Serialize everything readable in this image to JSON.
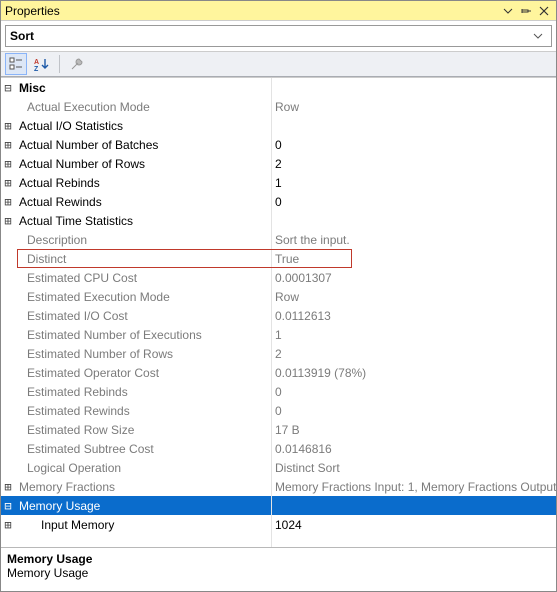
{
  "window": {
    "title": "Properties"
  },
  "object_name": "Sort",
  "category": {
    "label": "Misc"
  },
  "rows": [
    {
      "k": "actual-exec-mode",
      "label": "Actual Execution Mode",
      "value": "Row",
      "exp": "",
      "cls": "faded indent1"
    },
    {
      "k": "actual-io-stats",
      "label": "Actual I/O Statistics",
      "value": "",
      "exp": "⊞",
      "cls": "expandable"
    },
    {
      "k": "actual-batches",
      "label": "Actual Number of Batches",
      "value": "0",
      "exp": "⊞",
      "cls": "expandable"
    },
    {
      "k": "actual-rows",
      "label": "Actual Number of Rows",
      "value": "2",
      "exp": "⊞",
      "cls": "expandable"
    },
    {
      "k": "actual-rebinds",
      "label": "Actual Rebinds",
      "value": "1",
      "exp": "⊞",
      "cls": "expandable"
    },
    {
      "k": "actual-rewinds",
      "label": "Actual Rewinds",
      "value": "0",
      "exp": "⊞",
      "cls": "expandable"
    },
    {
      "k": "actual-time-stats",
      "label": "Actual Time Statistics",
      "value": "",
      "exp": "⊞",
      "cls": "expandable"
    },
    {
      "k": "description",
      "label": "Description",
      "value": "Sort the input.",
      "exp": "",
      "cls": "faded indent1"
    },
    {
      "k": "distinct",
      "label": "Distinct",
      "value": "True",
      "exp": "",
      "cls": "faded indent1 highlighted"
    },
    {
      "k": "est-cpu-cost",
      "label": "Estimated CPU Cost",
      "value": "0.0001307",
      "exp": "",
      "cls": "faded indent1"
    },
    {
      "k": "est-exec-mode",
      "label": "Estimated Execution Mode",
      "value": "Row",
      "exp": "",
      "cls": "faded indent1"
    },
    {
      "k": "est-io-cost",
      "label": "Estimated I/O Cost",
      "value": "0.0112613",
      "exp": "",
      "cls": "faded indent1"
    },
    {
      "k": "est-num-exec",
      "label": "Estimated Number of Executions",
      "value": "1",
      "exp": "",
      "cls": "faded indent1"
    },
    {
      "k": "est-num-rows",
      "label": "Estimated Number of Rows",
      "value": "2",
      "exp": "",
      "cls": "faded indent1"
    },
    {
      "k": "est-op-cost",
      "label": "Estimated Operator Cost",
      "value": "0.0113919 (78%)",
      "exp": "",
      "cls": "faded indent1"
    },
    {
      "k": "est-rebinds",
      "label": "Estimated Rebinds",
      "value": "0",
      "exp": "",
      "cls": "faded indent1"
    },
    {
      "k": "est-rewinds",
      "label": "Estimated Rewinds",
      "value": "0",
      "exp": "",
      "cls": "faded indent1"
    },
    {
      "k": "est-row-size",
      "label": "Estimated Row Size",
      "value": "17 B",
      "exp": "",
      "cls": "faded indent1"
    },
    {
      "k": "est-subtree-cost",
      "label": "Estimated Subtree Cost",
      "value": "0.0146816",
      "exp": "",
      "cls": "faded indent1"
    },
    {
      "k": "logical-op",
      "label": "Logical Operation",
      "value": "Distinct Sort",
      "exp": "",
      "cls": "faded indent1"
    },
    {
      "k": "mem-fractions",
      "label": "Memory Fractions",
      "value": "Memory Fractions Input: 1, Memory Fractions Output",
      "exp": "⊞",
      "cls": "faded"
    },
    {
      "k": "mem-usage",
      "label": "Memory Usage",
      "value": "",
      "exp": "⊟",
      "cls": "selected"
    },
    {
      "k": "input-memory",
      "label": "Input Memory",
      "value": "1024",
      "exp": "⊞",
      "cls": "indent2"
    }
  ],
  "description_pane": {
    "title": "Memory Usage",
    "body": "Memory Usage"
  },
  "icons": {
    "categorized": "categorized-icon",
    "alphabetical": "alphabetical-icon",
    "wrench": "wrench-icon",
    "dropdown": "dropdown-icon",
    "pin": "pin-icon",
    "close": "close-icon"
  }
}
